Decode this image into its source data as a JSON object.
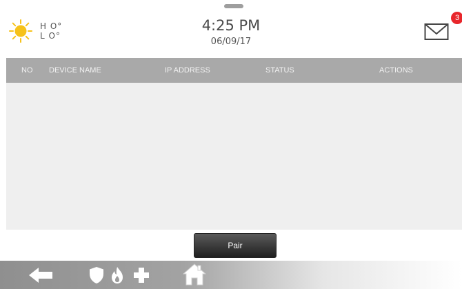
{
  "header": {
    "weather": {
      "icon": "sun-icon",
      "hi": "H O°",
      "lo": "L O°"
    },
    "time": "4:25 PM",
    "date": "06/09/17",
    "messages": {
      "icon": "envelope-icon",
      "count": "3"
    }
  },
  "table": {
    "columns": {
      "no": "NO",
      "device_name": "DEVICE NAME",
      "ip_address": "IP ADDRESS",
      "status": "STATUS",
      "actions": "ACTIONS"
    },
    "rows": []
  },
  "pair_button": {
    "label": "Pair"
  },
  "nav": {
    "back": {
      "icon": "back-arrow-icon"
    },
    "security": {
      "icon": "shield-icon"
    },
    "fire": {
      "icon": "flame-icon"
    },
    "medical": {
      "icon": "plus-icon"
    },
    "home": {
      "icon": "house-icon"
    }
  },
  "colors": {
    "header_bar": "#a9a9a9",
    "table_body": "#efefef",
    "badge": "#e8262b",
    "sun": "#f6c21a"
  }
}
